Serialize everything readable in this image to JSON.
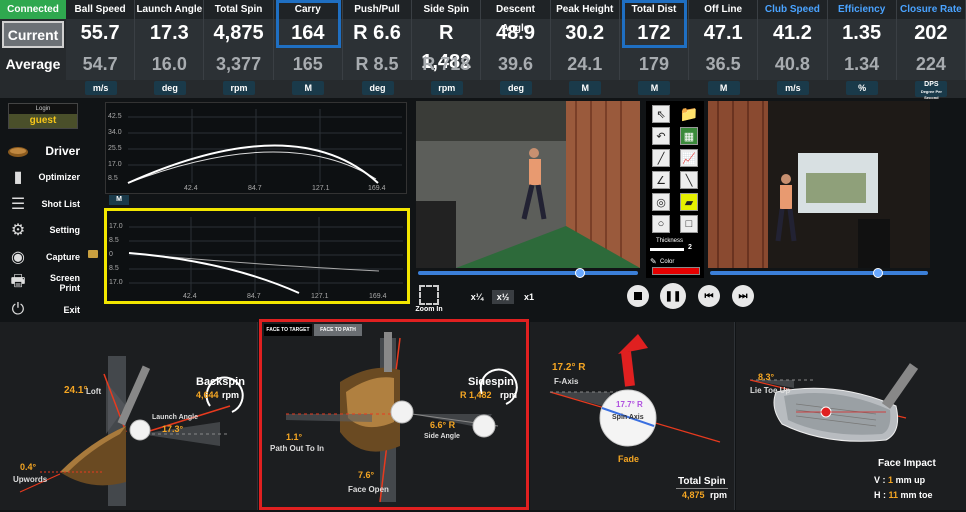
{
  "status": "Connected",
  "rows": {
    "current": "Current",
    "average": "Average"
  },
  "columns": [
    {
      "label": "Ball Speed",
      "current": "55.7",
      "average": "54.7",
      "unit": "m/s",
      "blue": false
    },
    {
      "label": "Launch Angle",
      "current": "17.3",
      "average": "16.0",
      "unit": "deg",
      "blue": false
    },
    {
      "label": "Total Spin",
      "current": "4,875",
      "average": "3,377",
      "unit": "rpm",
      "blue": false
    },
    {
      "label": "Carry",
      "current": "164",
      "average": "165",
      "unit": "M",
      "blue": false
    },
    {
      "label": "Push/Pull",
      "current": "R 6.6",
      "average": "R 8.5",
      "unit": "deg",
      "blue": false
    },
    {
      "label": "Side Spin",
      "current": "R 1,482",
      "average": "R 718",
      "unit": "rpm",
      "blue": false
    },
    {
      "label": "Descent Angle",
      "current": "48.9",
      "average": "39.6",
      "unit": "deg",
      "blue": false
    },
    {
      "label": "Peak Height",
      "current": "30.2",
      "average": "24.1",
      "unit": "M",
      "blue": false
    },
    {
      "label": "Total Dist",
      "current": "172",
      "average": "179",
      "unit": "M",
      "blue": false
    },
    {
      "label": "Off Line",
      "current": "47.1",
      "average": "36.5",
      "unit": "M",
      "blue": false
    },
    {
      "label": "Club Speed",
      "current": "41.2",
      "average": "40.8",
      "unit": "m/s",
      "blue": true
    },
    {
      "label": "Efficiency",
      "current": "1.35",
      "average": "1.34",
      "unit": "%",
      "blue": true
    },
    {
      "label": "Closure Rate",
      "current": "202",
      "average": "224",
      "unit": "DPS",
      "unit2": "Degree Per Second",
      "blue": true
    }
  ],
  "login": {
    "label": "Login",
    "user": "guest"
  },
  "club": "Driver",
  "menu": [
    "Optimizer",
    "Shot List",
    "Setting",
    "Capture",
    "Screen Print",
    "Exit"
  ],
  "graph_side_label": "M",
  "graph1": {
    "yticks": [
      "42.5",
      "34.0",
      "25.5",
      "17.0",
      "8.5"
    ],
    "xticks": [
      "42.4",
      "84.7",
      "127.1",
      "169.4"
    ]
  },
  "graph2": {
    "yticks": [
      "17.0",
      "8.5",
      "0",
      "8.5",
      "17.0"
    ],
    "xticks": [
      "42.4",
      "84.7",
      "127.1",
      "169.4"
    ]
  },
  "zoom_label": "Zoom In",
  "speeds": [
    "x¼",
    "x½",
    "x1"
  ],
  "thickness_label": "Thickness",
  "thickness_value": "2",
  "color_label": "Color",
  "panels": {
    "launch": {
      "loft_value": "24.1°",
      "loft_label": "Loft",
      "upwords_value": "0.4°",
      "upwords_label": "Upwords",
      "launch_label": "Launch Angle",
      "launch_value": "17.3°",
      "backspin_label": "Backspin",
      "backspin_value": "4,644",
      "backspin_unit": "rpm"
    },
    "face": {
      "tab1": "FACE TO TARGET",
      "tab2": "FACE TO PATH",
      "path_value": "1.1°",
      "path_label": "Path Out To In",
      "face_value": "7.6°",
      "face_label": "Face Open",
      "sidespin_label": "Sidespin",
      "sidespin_value": "R 1,482",
      "sidespin_unit": "rpm",
      "side_value": "6.6° R",
      "side_label": "Side Angle"
    },
    "spin": {
      "faxis_value": "17.2° R",
      "faxis_label": "F-Axis",
      "axis_value": "17.7° R",
      "axis_label": "Spin Axis",
      "shape": "Fade",
      "total_label": "Total Spin",
      "total_value": "4,875",
      "total_unit": "rpm"
    },
    "impact": {
      "lie_value": "8.3°",
      "lie_label": "Lie Toe Up",
      "title": "Face Impact",
      "v_label": "V :",
      "v_value": "1",
      "v_text": "mm up",
      "h_label": "H :",
      "h_value": "11",
      "h_text": "mm toe"
    }
  },
  "colors": {
    "accent_orange": "#f5a623",
    "highlight_blue": "#1f6fc2",
    "highlight_red": "#e02020",
    "highlight_yellow": "#f2e600"
  }
}
